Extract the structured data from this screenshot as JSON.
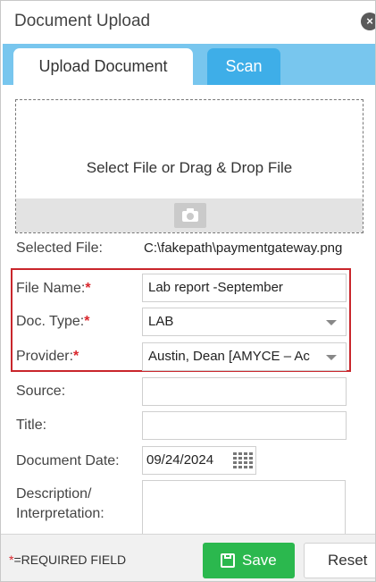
{
  "dialog": {
    "title": "Document Upload",
    "close_icon": "close-icon"
  },
  "tabs": [
    {
      "label": "Upload Document",
      "active": true
    },
    {
      "label": "Scan",
      "active": false
    }
  ],
  "dropzone": {
    "text": "Select File or Drag & Drop File",
    "icon": "camera-icon"
  },
  "selected_file": {
    "label": "Selected File:",
    "value": "C:\\fakepath\\paymentgateway.png"
  },
  "required_marker": "*",
  "fields": {
    "file_name": {
      "label": "File Name:",
      "value": "Lab report -September",
      "required": true
    },
    "doc_type": {
      "label": "Doc. Type:",
      "value": "LAB",
      "required": true
    },
    "provider": {
      "label": "Provider:",
      "value": "Austin, Dean [AMYCE – Ac",
      "required": true
    },
    "source": {
      "label": "Source:",
      "value": ""
    },
    "title": {
      "label": "Title:",
      "value": ""
    },
    "document_date": {
      "label": "Document Date:",
      "value": "09/24/2024",
      "icon": "calendar-icon"
    },
    "description": {
      "label_line1": "Description/",
      "label_line2": "Interpretation:",
      "value": ""
    }
  },
  "footer": {
    "required_note_star": "*",
    "required_note_text": "=REQUIRED FIELD",
    "save_label": "Save",
    "save_icon": "floppy-disk-icon",
    "reset_label": "Reset"
  },
  "colors": {
    "tab_bar": "#78c6ee",
    "scan_tab": "#3eaee8",
    "required": "#d9262c",
    "save_button": "#2bb84e"
  }
}
